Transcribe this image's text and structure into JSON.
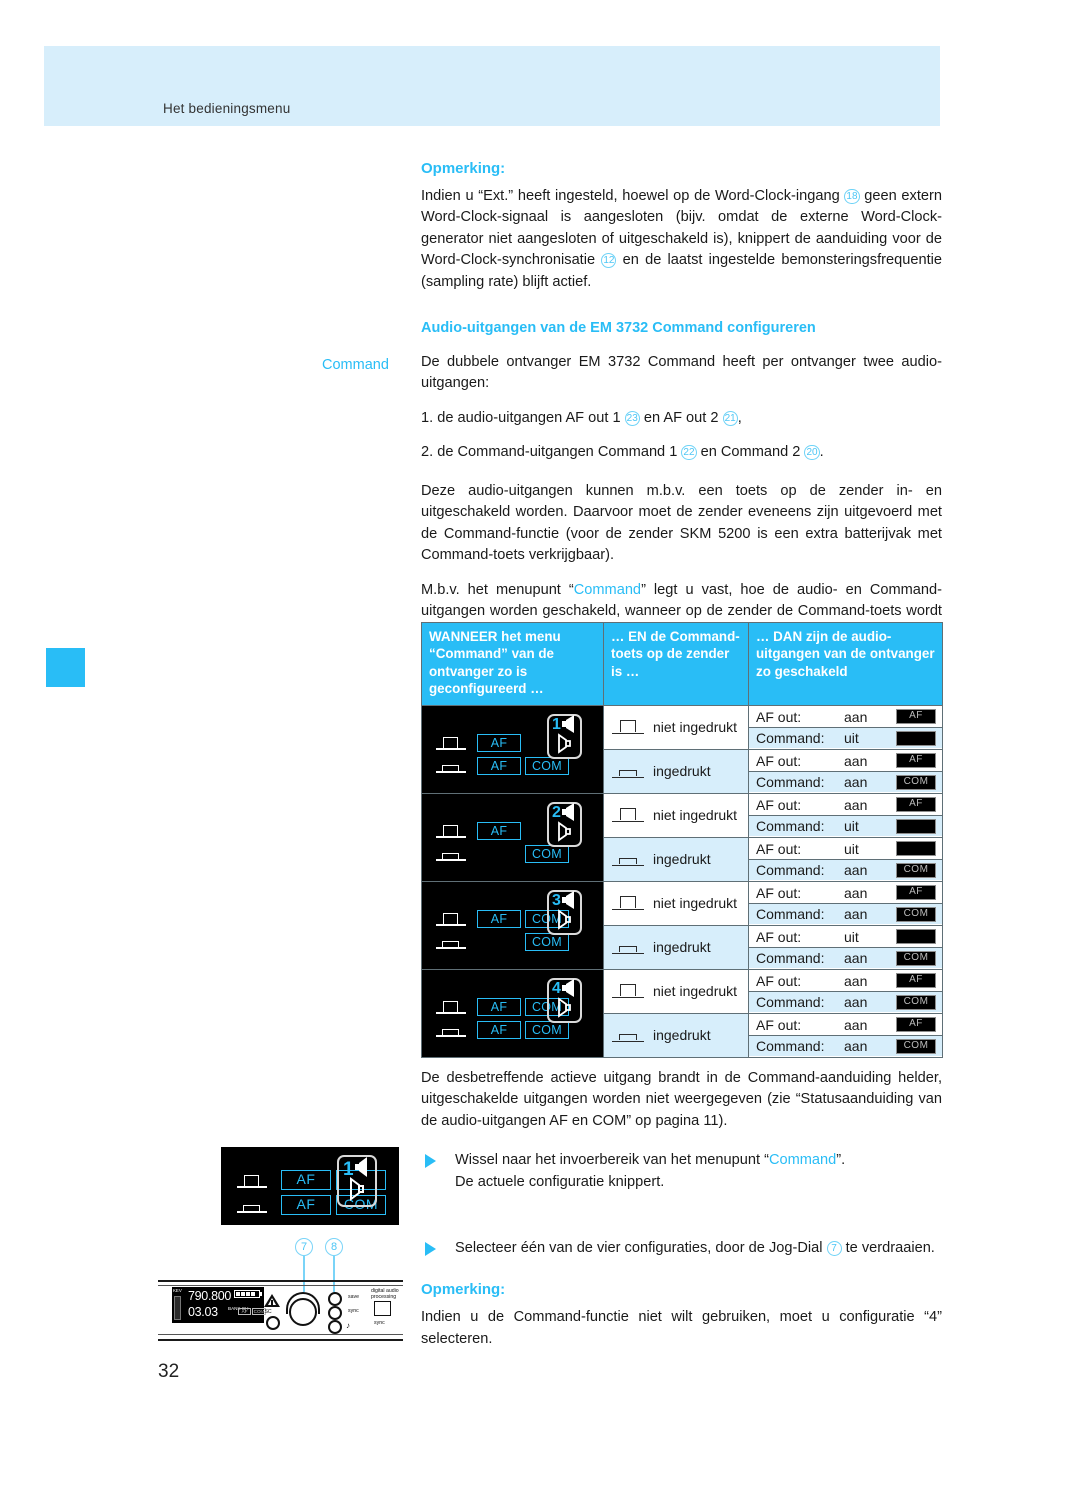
{
  "header": {
    "running_title": "Het bedieningsmenu"
  },
  "page_number": "32",
  "note1": {
    "title": "Opmerking:",
    "body_a": "Indien u “Ext.” heeft ingesteld, hoewel op de Word-Clock-ingang",
    "ref_18": "18",
    "body_b": "geen extern Word-Clock-signaal is aangesloten (bijv. omdat de externe Word-Clock-generator niet aangesloten of uitgeschakeld is), knippert de aanduiding voor de Word-Clock-synchronisatie",
    "ref_12": "12",
    "body_c": "en de laatst ingestelde bemonsteringsfrequentie (sampling rate) blijft actief."
  },
  "section": {
    "heading": "Audio-uitgangen van de EM 3732 Command configureren",
    "margin_label": "Command",
    "intro": "De dubbele ontvanger EM 3732 Command heeft per ontvanger twee audio-uitgangen:",
    "list_1_a": "1. de audio-uitgangen AF out 1",
    "list_1_ref_a": "23",
    "list_1_b": "en AF out 2",
    "list_1_ref_b": "21",
    "list_1_c": ",",
    "list_2_a": "2. de Command-uitgangen Command 1",
    "list_2_ref_a": "22",
    "list_2_b": "en Command 2",
    "list_2_ref_b": "20",
    "list_2_c": ".",
    "para_2": "Deze audio-uitgangen kunnen m.b.v. een toets op de zender in- en uitgeschakeld worden. Daarvoor moet de zender eveneens zijn uitgevoerd met de Command-functie (voor de zender SKM 5200 is een extra batterijvak met Command-toets verkrijgbaar).",
    "para_3_a": "M.b.v. het menupunt “",
    "para_3_hl": "Command",
    "para_3_b": "” legt u vast, hoe de audio- en Command-uitgangen worden geschakeld, wanneer op de zender de Command-toets wordt ingedrukt. U heeft vier verschillende configuratiemogelijkheden:"
  },
  "table": {
    "headers": [
      "WANNEER het menu “Command” van de ontvanger zo is geconfigureerd …",
      "… EN de Command-toets op de zender is …",
      "… DAN zijn de audio-uitgangen van de ontvanger zo geschakeld"
    ],
    "rows": [
      {
        "config": "1",
        "lcd": {
          "top": [
            "AF",
            ""
          ],
          "bottom": [
            "AF",
            "COM"
          ]
        },
        "states": [
          {
            "press": "niet ingedrukt",
            "outs": [
              {
                "label": "AF out:",
                "value": "aan",
                "badge": "AF"
              },
              {
                "label": "Command:",
                "value": "uit",
                "badge": ""
              }
            ]
          },
          {
            "press": "ingedrukt",
            "outs": [
              {
                "label": "AF out:",
                "value": "aan",
                "badge": "AF"
              },
              {
                "label": "Command:",
                "value": "aan",
                "badge": "COM"
              }
            ]
          }
        ]
      },
      {
        "config": "2",
        "lcd": {
          "top": [
            "AF",
            ""
          ],
          "bottom": [
            "",
            "COM"
          ]
        },
        "states": [
          {
            "press": "niet ingedrukt",
            "outs": [
              {
                "label": "AF out:",
                "value": "aan",
                "badge": "AF"
              },
              {
                "label": "Command:",
                "value": "uit",
                "badge": ""
              }
            ]
          },
          {
            "press": "ingedrukt",
            "outs": [
              {
                "label": "AF out:",
                "value": "uit",
                "badge": ""
              },
              {
                "label": "Command:",
                "value": "aan",
                "badge": "COM"
              }
            ]
          }
        ]
      },
      {
        "config": "3",
        "lcd": {
          "top": [
            "AF",
            "COM"
          ],
          "bottom": [
            "",
            "COM"
          ]
        },
        "states": [
          {
            "press": "niet ingedrukt",
            "outs": [
              {
                "label": "AF out:",
                "value": "aan",
                "badge": "AF"
              },
              {
                "label": "Command:",
                "value": "aan",
                "badge": "COM"
              }
            ]
          },
          {
            "press": "ingedrukt",
            "outs": [
              {
                "label": "AF out:",
                "value": "uit",
                "badge": ""
              },
              {
                "label": "Command:",
                "value": "aan",
                "badge": "COM"
              }
            ]
          }
        ]
      },
      {
        "config": "4",
        "lcd": {
          "top": [
            "AF",
            "COM"
          ],
          "bottom": [
            "AF",
            "COM"
          ]
        },
        "states": [
          {
            "press": "niet ingedrukt",
            "outs": [
              {
                "label": "AF out:",
                "value": "aan",
                "badge": "AF"
              },
              {
                "label": "Command:",
                "value": "aan",
                "badge": "COM"
              }
            ]
          },
          {
            "press": "ingedrukt",
            "outs": [
              {
                "label": "AF out:",
                "value": "aan",
                "badge": "AF"
              },
              {
                "label": "Command:",
                "value": "aan",
                "badge": "COM"
              }
            ]
          }
        ]
      }
    ]
  },
  "after_table": {
    "para_a": "De desbetreffende actieve uitgang brandt in de Command-aanduiding helder, uitgeschakelde uitgangen worden niet weergegeven (zie “Statusaanduiding van de audio-uitgangen AF en COM” op pagina 11).",
    "step1_a": "Wissel naar het invoerbereik van het menupunt “",
    "step1_hl": "Command",
    "step1_b": "”.",
    "step1_c": "De actuele configuratie knippert.",
    "step2_a": "Selecteer één van de vier configuraties, door de Jog-Dial",
    "step2_ref": "7",
    "step2_b": "te verdraaien."
  },
  "note2": {
    "title": "Opmerking:",
    "body": "Indien u de Command-functie niet wilt gebruiken, moet u configuratie “4” selecteren."
  },
  "margin_illustration": {
    "lcd": {
      "config": "1",
      "top": [
        "AF",
        ""
      ],
      "bottom": [
        "AF",
        "COM"
      ]
    },
    "callouts": [
      "7",
      "8"
    ],
    "device": {
      "frequency": "790.800",
      "freq_unit": "MHz",
      "channel": "03.03",
      "channel_unit": "BANK CH",
      "badge_af": "AF",
      "badge_com": "COM",
      "label_kev": "KEV",
      "label_esc": "ESC",
      "label_save": "save",
      "label_sync1": "sync",
      "label_sync2": "sync",
      "label_dap": "digital audio processing"
    }
  },
  "colors": {
    "accent": "#29bdf6",
    "band": "#d7eefb",
    "tint": "#d7eefb"
  }
}
